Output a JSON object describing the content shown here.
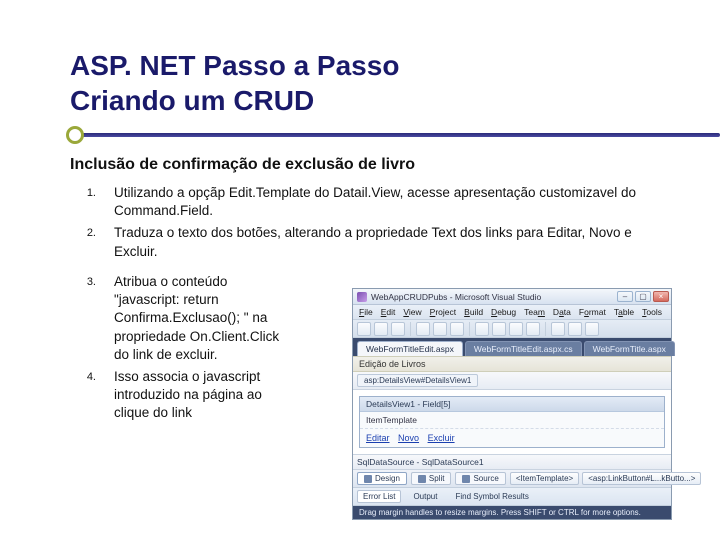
{
  "title_line1": "ASP. NET Passo a Passo",
  "title_line2": "Criando um CRUD",
  "subheading": "Inclusão de confirmação de exclusão de livro",
  "steps": [
    {
      "num": "1.",
      "text": "Utilizando a opçãp Edit.Template do Datail.View, acesse apresentação customizavel do Command.Field."
    },
    {
      "num": "2.",
      "text": "Traduza o texto dos botões, alterando a propriedade Text dos links para Editar, Novo e Excluir."
    },
    {
      "num": "3.",
      "text": "Atribua o conteúdo \"javascript: return Confirma.Exclusao(); \" na propriedade On.Client.Click do link de excluir."
    },
    {
      "num": "4.",
      "text": "Isso associa o javascript introduzido na página ao clique do link"
    }
  ],
  "ide": {
    "window_title": "WebAppCRUDPubs - Microsoft Visual Studio",
    "menus": [
      "File",
      "Edit",
      "View",
      "Project",
      "Build",
      "Debug",
      "Team",
      "Data",
      "Format",
      "Table",
      "Tools"
    ],
    "tabs": [
      {
        "label": "WebFormTitleEdit.aspx",
        "active": true
      },
      {
        "label": "WebFormTitleEdit.aspx.cs",
        "active": false
      },
      {
        "label": "WebFormTitle.aspx",
        "active": false
      }
    ],
    "page_heading": "Edição de Livros",
    "breadcrumb": "asp:DetailsView#DetailsView1",
    "template_header": "DetailsView1 - Field[5]",
    "template_row": "ItemTemplate",
    "links": [
      "Editar",
      "Novo",
      "Excluir"
    ],
    "datasource_label": "SqlDataSource - SqlDataSource1",
    "view_tabs": [
      "Design",
      "Split",
      "Source"
    ],
    "tag_chips": [
      "<ItemTemplate>",
      "<asp:LinkButton#L...kButto...>"
    ],
    "output_tabs": [
      "Error List",
      "Output",
      "Find Symbol Results"
    ],
    "status": "Drag margin handles to resize margins. Press SHIFT or CTRL for more options."
  }
}
